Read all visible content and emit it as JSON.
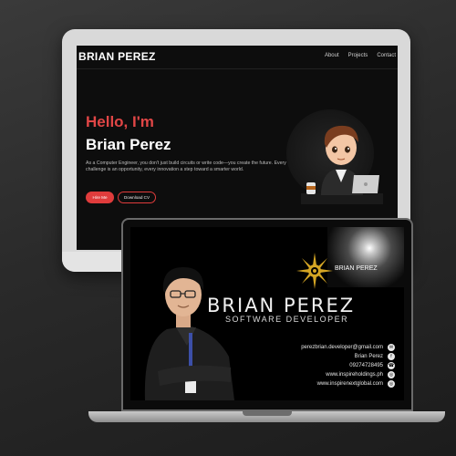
{
  "website": {
    "brand": "BRIAN PEREZ",
    "nav": [
      "About",
      "Projects",
      "Contact"
    ],
    "hello": "Hello, I'm",
    "name": "Brian Perez",
    "description": "As a Computer Engineer, you don't just build circuits or write code—you create the future. Every challenge is an opportunity, every innovation a step toward a smarter world.",
    "hire_button": "Hire Me",
    "cv_button": "Download CV"
  },
  "card": {
    "tag": "BRIAN PEREZ",
    "name": "BRIAN PEREZ",
    "role": "SOFTWARE DEVELOPER",
    "contacts": [
      {
        "text": "perezbrian.developer@gmail.com",
        "icon": "mail-icon"
      },
      {
        "text": "Brian Perez",
        "icon": "social-icon"
      },
      {
        "text": "09274728495",
        "icon": "phone-icon"
      },
      {
        "text": "www.inspireholdings.ph",
        "icon": "globe-icon"
      },
      {
        "text": "www.inspirenextglobal.com",
        "icon": "globe-icon"
      }
    ]
  },
  "colors": {
    "accent": "#e03c3c",
    "gold": "#d4a524"
  }
}
